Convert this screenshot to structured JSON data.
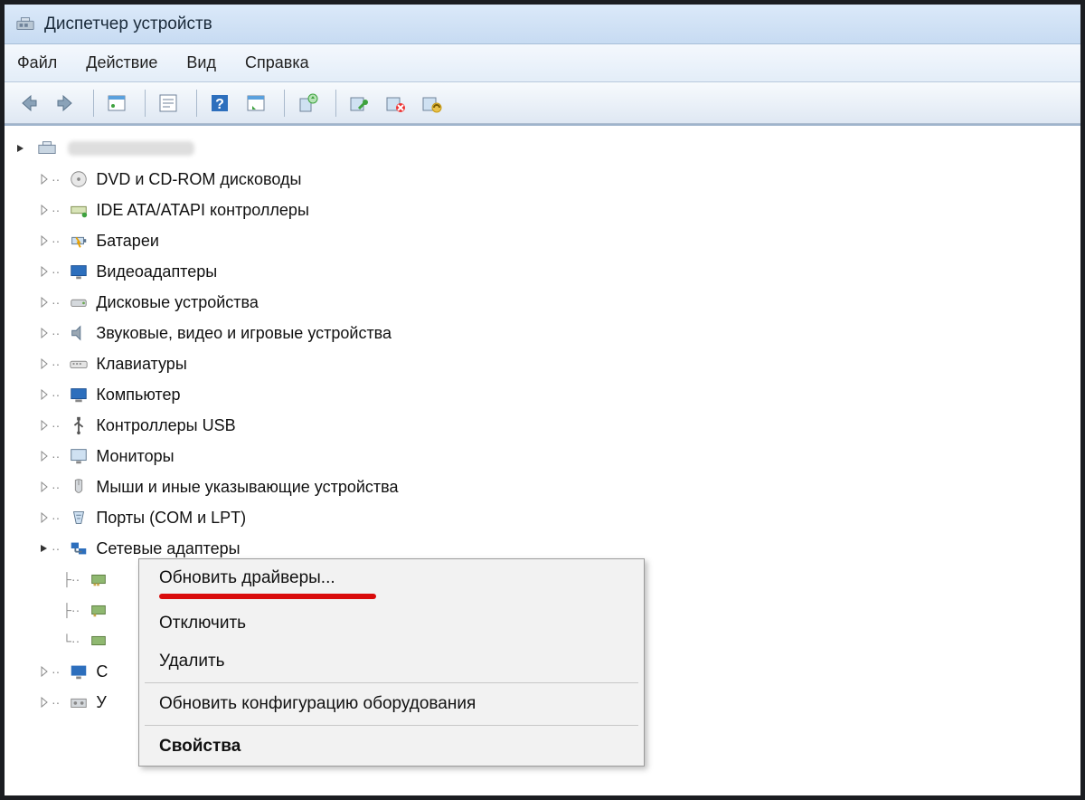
{
  "title": "Диспетчер устройств",
  "menu": {
    "file": "Файл",
    "action": "Действие",
    "view": "Вид",
    "help": "Справка"
  },
  "tree": {
    "root": "",
    "items": [
      "DVD и CD-ROM дисководы",
      "IDE ATA/ATAPI контроллеры",
      "Батареи",
      "Видеоадаптеры",
      "Дисковые устройства",
      "Звуковые, видео и игровые устройства",
      "Клавиатуры",
      "Компьютер",
      "Контроллеры USB",
      "Мониторы",
      "Мыши и иные указывающие устройства",
      "Порты (COM и LPT)",
      "Сетевые адаптеры"
    ],
    "cut1": "С",
    "cut2": "У"
  },
  "context": {
    "update": "Обновить драйверы...",
    "disable": "Отключить",
    "remove": "Удалить",
    "rescan": "Обновить конфигурацию оборудования",
    "props": "Свойства"
  }
}
